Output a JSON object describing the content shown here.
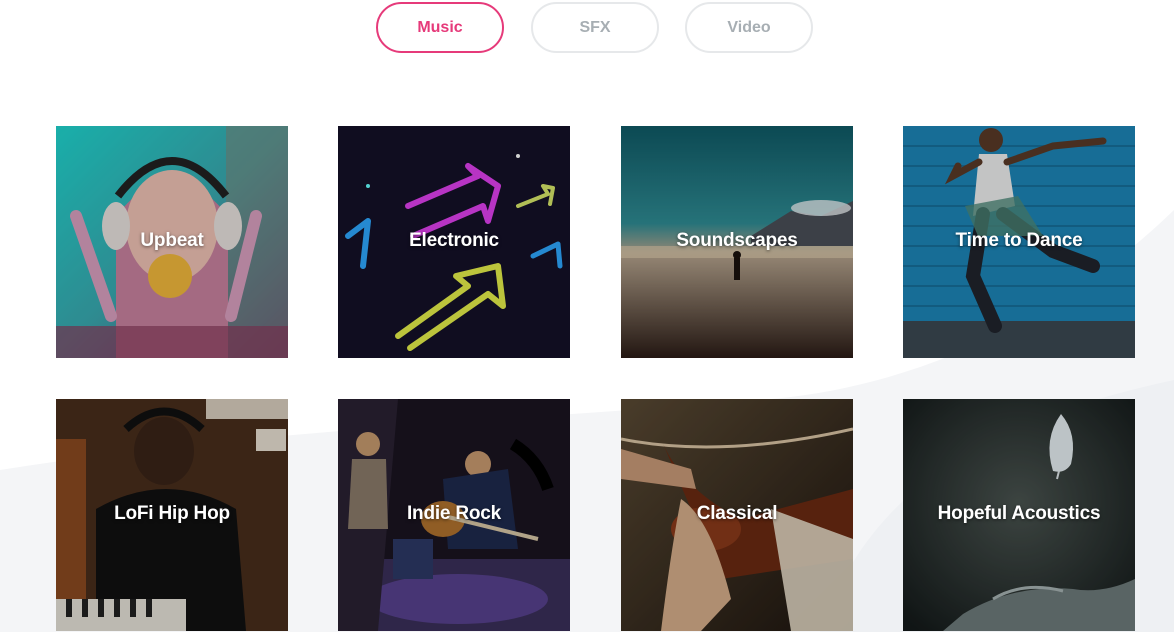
{
  "tabs": [
    {
      "label": "Music",
      "active": true
    },
    {
      "label": "SFX",
      "active": false
    },
    {
      "label": "Video",
      "active": false
    }
  ],
  "accent_color": "#e63a7a",
  "genres": [
    {
      "label": "Upbeat",
      "image": "woman-headphones-bubblegum"
    },
    {
      "label": "Electronic",
      "image": "neon-arrows"
    },
    {
      "label": "Soundscapes",
      "image": "person-walking-beach"
    },
    {
      "label": "Time to Dance",
      "image": "man-dancing-blue-wall"
    },
    {
      "label": "LoFi Hip Hop",
      "image": "man-headphones-keyboard"
    },
    {
      "label": "Indie Rock",
      "image": "band-on-stage"
    },
    {
      "label": "Classical",
      "image": "violin-player"
    },
    {
      "label": "Hopeful Acoustics",
      "image": "feather-over-hand"
    }
  ]
}
